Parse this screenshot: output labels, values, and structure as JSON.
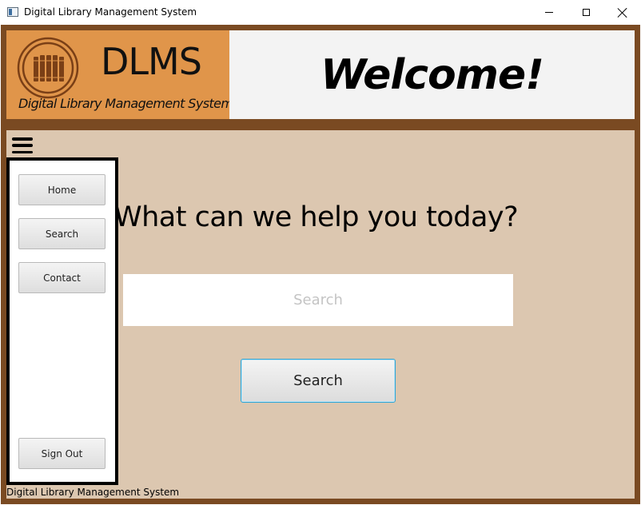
{
  "window": {
    "title": "Digital Library Management System",
    "icon": "app-window-icon",
    "controls": {
      "minimize": "minimize-icon",
      "maximize": "maximize-icon",
      "close": "close-icon"
    }
  },
  "header": {
    "logo": {
      "abbrev": "DLMS",
      "subtitle": "Digital Library Management System",
      "emblem": "books-emblem"
    },
    "welcome": "Welcome!"
  },
  "sidebar": {
    "menu_icon": "hamburger-icon",
    "items": [
      {
        "label": "Home"
      },
      {
        "label": "Search"
      },
      {
        "label": "Contact"
      }
    ],
    "sign_out": "Sign Out"
  },
  "main": {
    "prompt": "What can we help you today?",
    "search": {
      "placeholder": "Search",
      "value": ""
    },
    "search_button": "Search"
  },
  "footer": {
    "text": "Digital Library Management System"
  },
  "colors": {
    "frame": "#7a4a22",
    "logo_bg": "#e0954a",
    "welcome_bg": "#f3f3f3",
    "content_bg": "#dcc7b0",
    "accent": "#2ea6d6"
  }
}
